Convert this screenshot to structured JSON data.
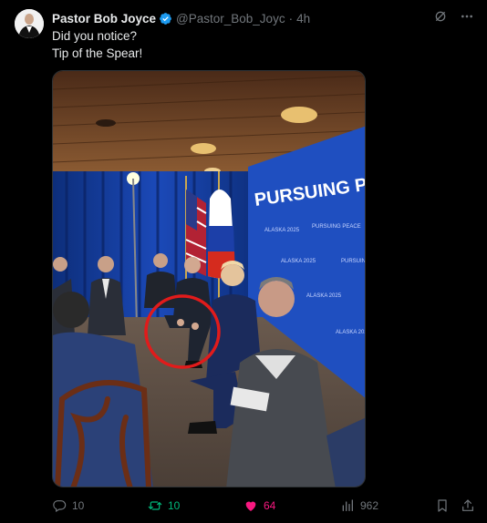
{
  "author": {
    "display_name": "Pastor Bob Joyce",
    "handle": "@Pastor_Bob_Joyc",
    "time": "4h",
    "verified": true,
    "verified_color": "#1d9bf0"
  },
  "post": {
    "lines": [
      "Did you notice?",
      "Tip of the Spear!"
    ]
  },
  "media": {
    "banner_text": "PURSUING P",
    "banner_small_text": "PURSUING PEACE",
    "banner_location": "ALASKA 2025",
    "highlight_color": "#e11b1b"
  },
  "actions": {
    "replies": "10",
    "reposts": "10",
    "likes": "64",
    "views": "962",
    "repost_color": "#00ba7c",
    "like_color": "#f91880"
  },
  "icons": {
    "verified": "verified-badge-icon",
    "grok": "grok-icon",
    "more": "more-icon",
    "reply": "reply-icon",
    "repost": "repost-icon",
    "like": "heart-icon",
    "views": "views-icon",
    "bookmark": "bookmark-icon",
    "share": "share-icon"
  }
}
